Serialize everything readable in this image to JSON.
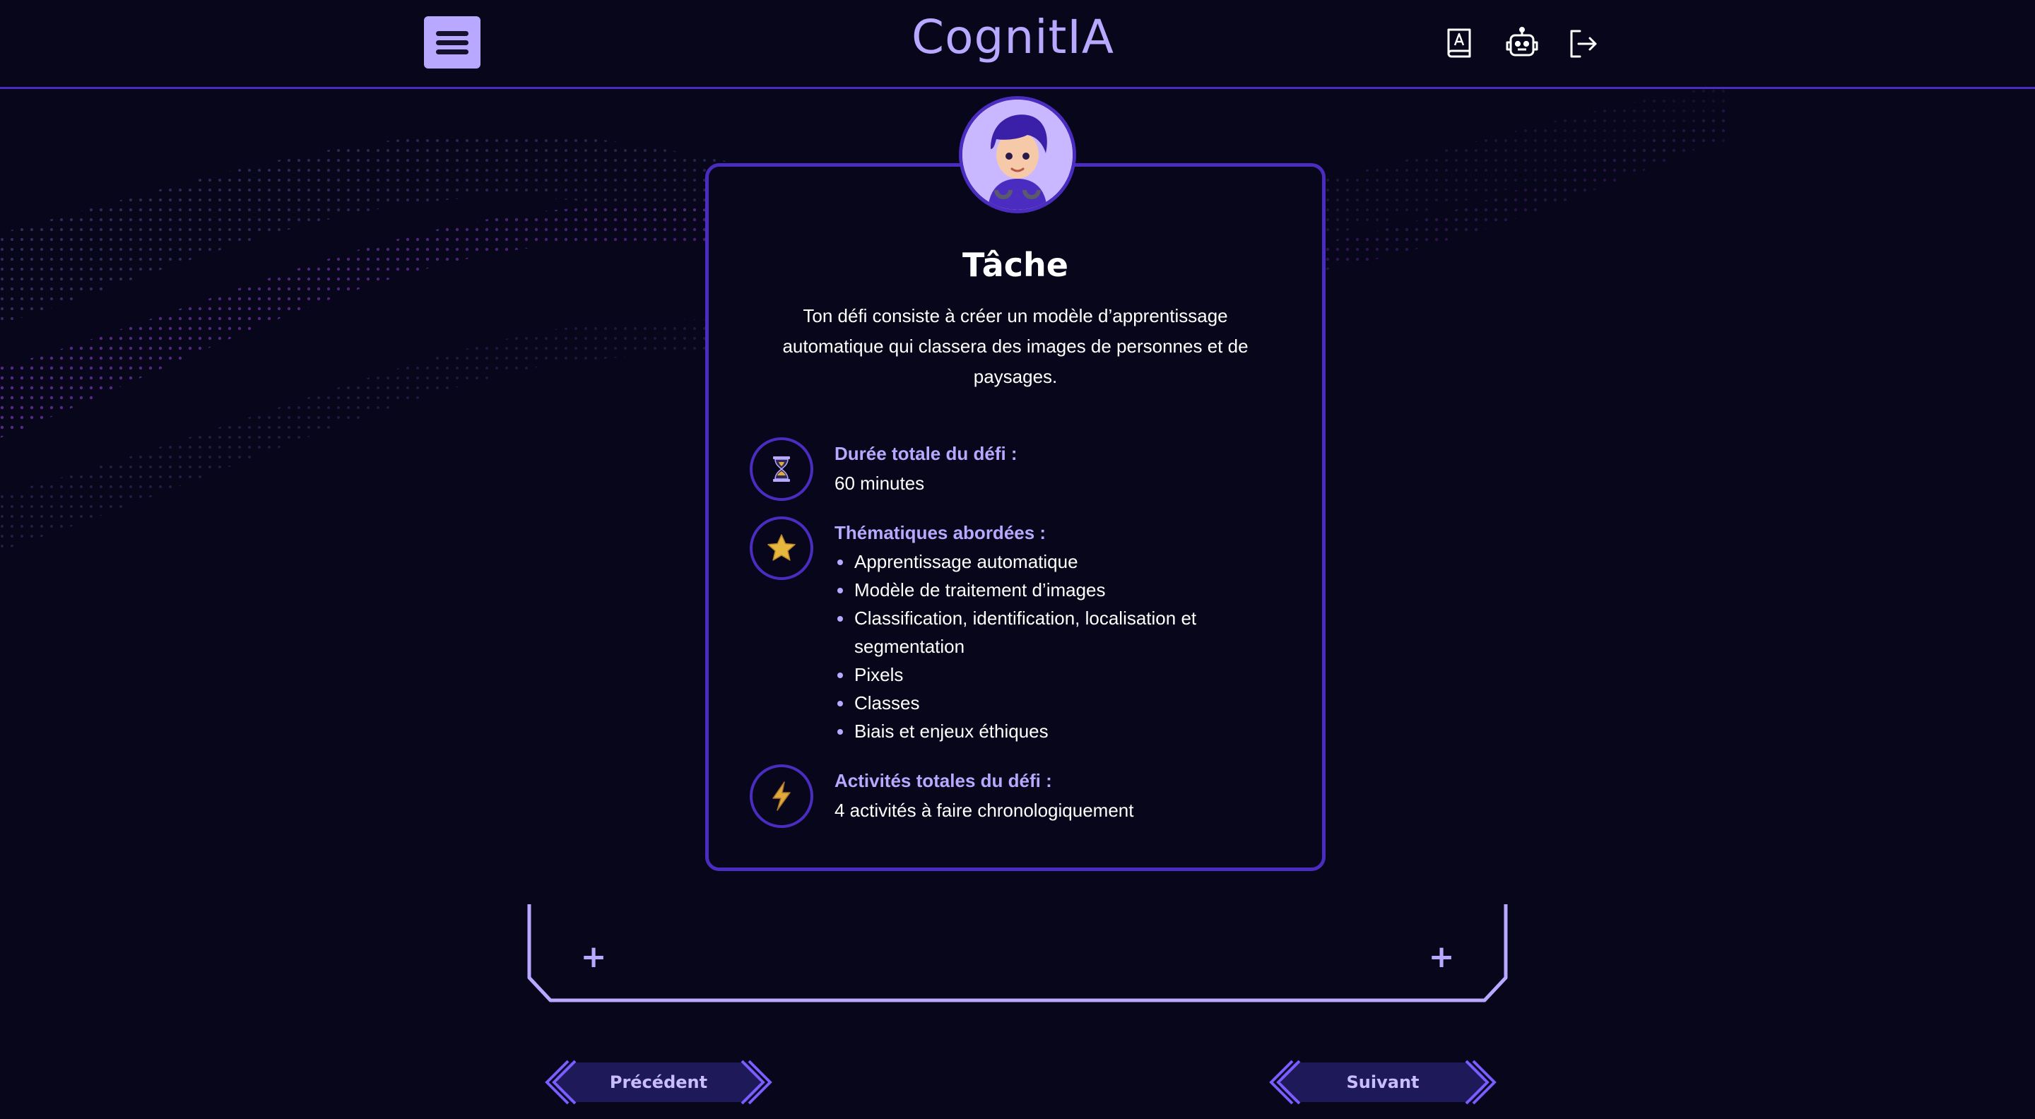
{
  "header": {
    "brand": "CognitIA",
    "icons": [
      "menu-icon",
      "dictionary-icon",
      "robot-icon",
      "logout-icon"
    ]
  },
  "card": {
    "title": "Tâche",
    "description": "Ton défi consiste à créer un modèle d’apprentissage automatique qui classera des images de personnes et de paysages.",
    "duration": {
      "label": "Durée totale du défi :",
      "value": "60 minutes",
      "icon": "hourglass-icon"
    },
    "topics": {
      "label": "Thématiques abordées :",
      "icon": "star-icon",
      "items": [
        "Apprentissage automatique",
        "Modèle de traitement d’images",
        "Classification, identification, localisation et segmentation",
        "Pixels",
        "Classes",
        "Biais et enjeux éthiques"
      ]
    },
    "activities": {
      "label": "Activités totales du défi :",
      "value": "4 activités à faire chronologiquement",
      "icon": "lightning-icon"
    }
  },
  "frame": {
    "left_plus": "+",
    "right_plus": "+"
  },
  "nav": {
    "prev_label": "Précédent",
    "next_label": "Suivant"
  },
  "colors": {
    "background": "#07061a",
    "accent": "#4b2cc0",
    "accent_light": "#b8a8ff",
    "text": "#ffffff"
  }
}
